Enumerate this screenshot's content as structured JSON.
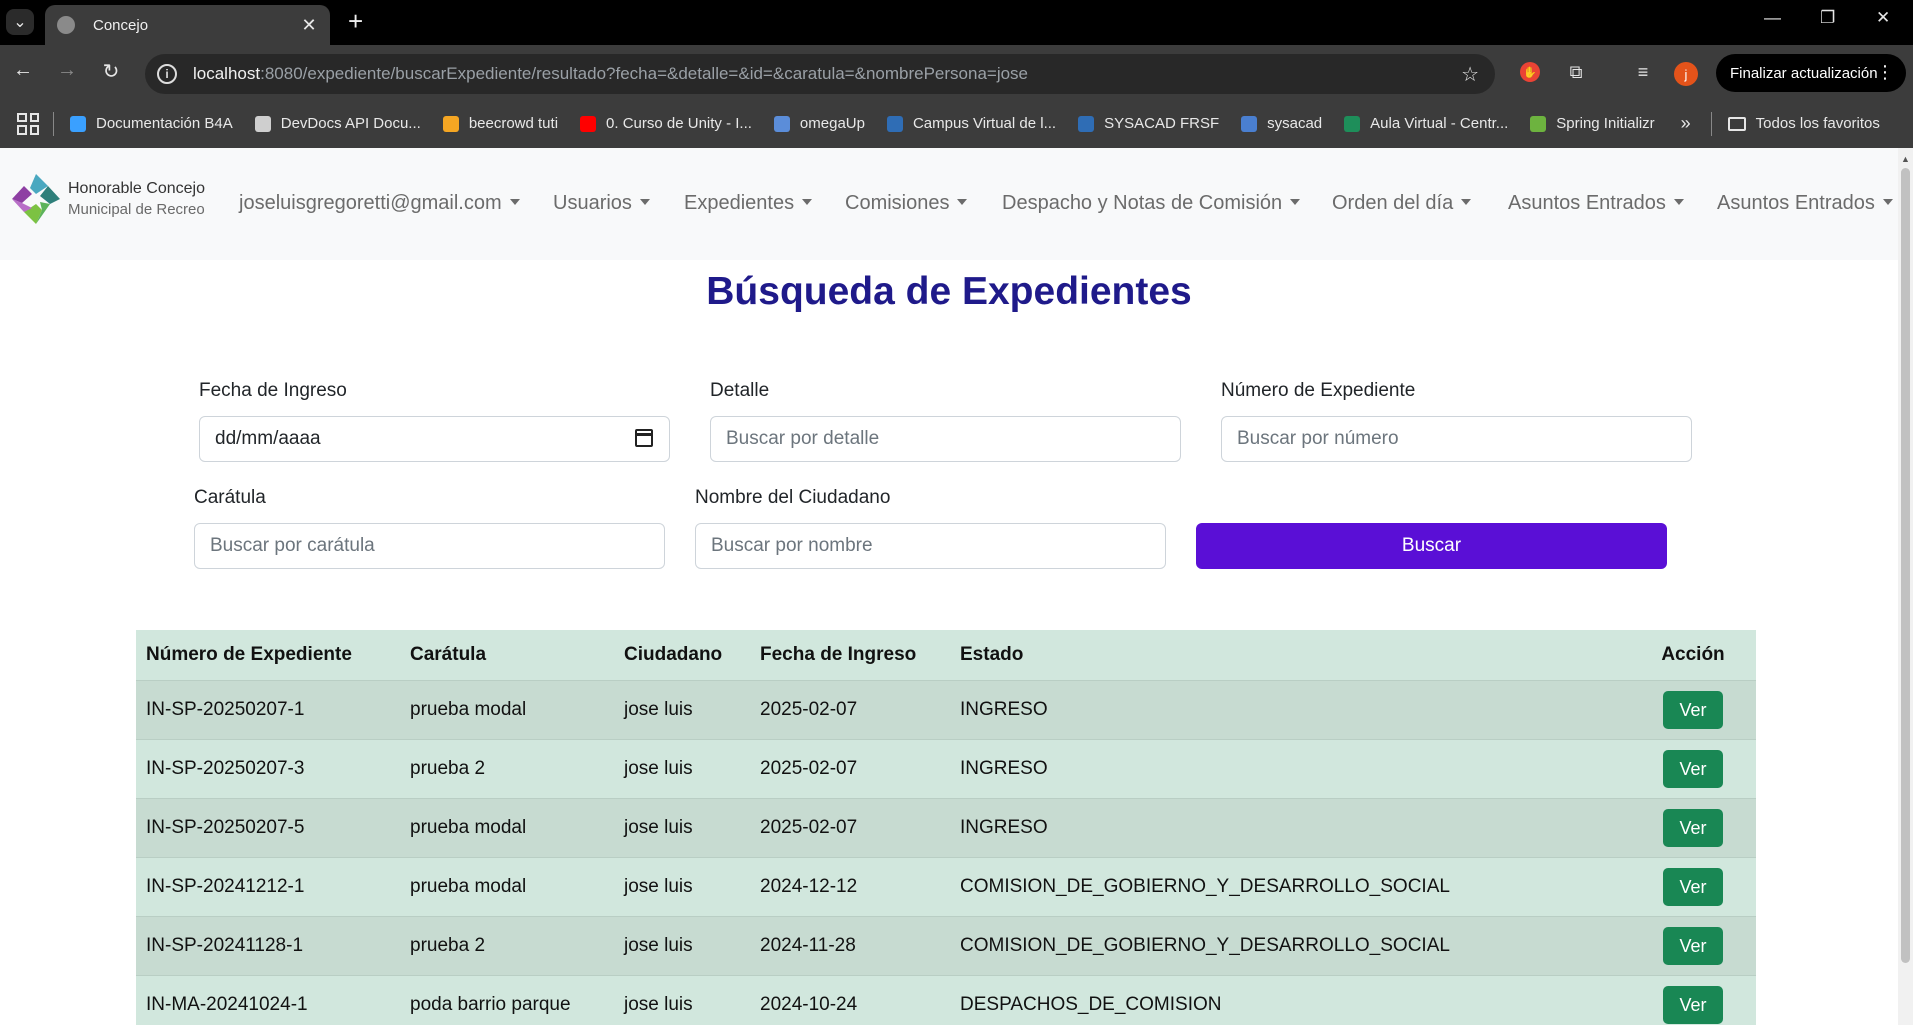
{
  "browser": {
    "tab_title": "Concejo",
    "url_host": "localhost",
    "url_rest": ":8080/expediente/buscarExpediente/resultado?fecha=&detalle=&id=&caratula=&nombrePersona=jose",
    "avatar_letter": "j",
    "update_label": "Finalizar actualización",
    "bookmarks": [
      {
        "label": "Documentación B4A",
        "color": "#3aa0ff"
      },
      {
        "label": "DevDocs API Docu...",
        "color": "#cfcfcf"
      },
      {
        "label": "beecrowd tuti",
        "color": "#f5a623"
      },
      {
        "label": "0. Curso de Unity - I...",
        "color": "#ff0000"
      },
      {
        "label": "omegaUp",
        "color": "#5b8dd9"
      },
      {
        "label": "Campus Virtual de l...",
        "color": "#2f6db5"
      },
      {
        "label": "SYSACAD FRSF",
        "color": "#2f6db5"
      },
      {
        "label": "sysacad",
        "color": "#4a7fd0"
      },
      {
        "label": "Aula Virtual - Centr...",
        "color": "#1e8e5a"
      },
      {
        "label": "Spring Initializr",
        "color": "#6db33f"
      }
    ],
    "bookmarks_all": "Todos los favoritos"
  },
  "navbar": {
    "brand_line1": "Honorable Concejo",
    "brand_line2": "Municipal de Recreo",
    "items": [
      "joseluisgregoretti@gmail.com",
      "Usuarios",
      "Expedientes",
      "Comisiones",
      "Despacho y Notas de Comisión",
      "Orden del día",
      "Asuntos Entrados",
      "Asuntos Entrados"
    ]
  },
  "search": {
    "title": "Búsqueda de Expedientes",
    "fecha_label": "Fecha de Ingreso",
    "fecha_value": "dd/mm/aaaa",
    "detalle_label": "Detalle",
    "detalle_placeholder": "Buscar por detalle",
    "numero_label": "Número de Expediente",
    "numero_placeholder": "Buscar por número",
    "caratula_label": "Carátula",
    "caratula_placeholder": "Buscar por carátula",
    "nombre_label": "Nombre del Ciudadano",
    "nombre_placeholder": "Buscar por nombre",
    "button_label": "Buscar"
  },
  "table": {
    "headers": [
      "Número de Expediente",
      "Carátula",
      "Ciudadano",
      "Fecha de Ingreso",
      "Estado",
      "Acción"
    ],
    "action_label": "Ver",
    "rows": [
      [
        "IN-SP-20250207-1",
        "prueba modal",
        "jose luis",
        "2025-02-07",
        "INGRESO"
      ],
      [
        "IN-SP-20250207-3",
        "prueba 2",
        "jose luis",
        "2025-02-07",
        "INGRESO"
      ],
      [
        "IN-SP-20250207-5",
        "prueba modal",
        "jose luis",
        "2025-02-07",
        "INGRESO"
      ],
      [
        "IN-SP-20241212-1",
        "prueba modal",
        "jose luis",
        "2024-12-12",
        "COMISION_DE_GOBIERNO_Y_DESARROLLO_SOCIAL"
      ],
      [
        "IN-SP-20241128-1",
        "prueba 2",
        "jose luis",
        "2024-11-28",
        "COMISION_DE_GOBIERNO_Y_DESARROLLO_SOCIAL"
      ],
      [
        "IN-MA-20241024-1",
        "poda barrio parque",
        "jose luis",
        "2024-10-24",
        "DESPACHOS_DE_COMISION"
      ]
    ]
  }
}
